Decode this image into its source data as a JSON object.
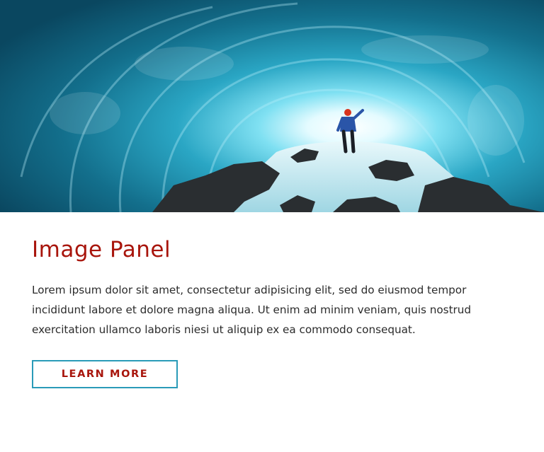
{
  "panel": {
    "title": "Image Panel",
    "body": "Lorem ipsum dolor sit amet, consectetur adipisicing elit, sed do eiusmod tempor incididunt labore et dolore magna aliqua. Ut enim ad minim veniam, quis nostrud exercitation ullamco laboris niesi ut aliquip ex ea commodo consequat.",
    "cta_label": "LEARN MORE"
  },
  "colors": {
    "title": "#a8150c",
    "button_border": "#2a9bb8",
    "button_text": "#a8150c",
    "body_text": "#2b2b2b"
  }
}
